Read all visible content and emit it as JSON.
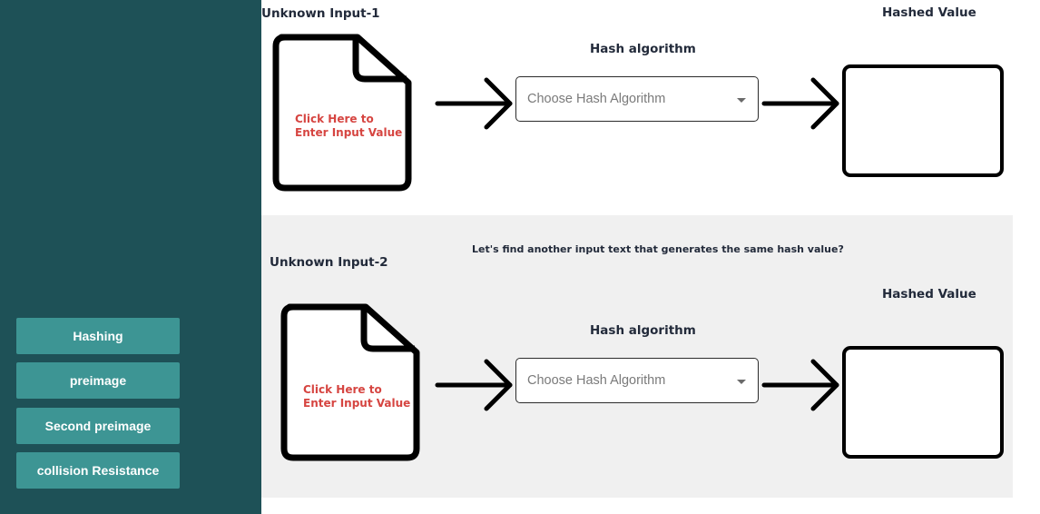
{
  "sidebar": {
    "items": [
      {
        "label": "Hashing"
      },
      {
        "label": "preimage"
      },
      {
        "label": "Second preimage"
      },
      {
        "label": "collision Resistance"
      }
    ]
  },
  "section1": {
    "input_title": "Unknown Input-1",
    "doc_text_line1": "Click Here to",
    "doc_text_line2": "Enter Input Value",
    "algo_title": "Hash algorithm",
    "select_placeholder": "Choose Hash Algorithm",
    "output_title": "Hashed Value",
    "output_value": ""
  },
  "section2": {
    "prompt": "Let's find another input text that generates the same hash value?",
    "input_title": "Unknown Input-2",
    "doc_text_line1": "Click Here to",
    "doc_text_line2": "Enter Input Value",
    "algo_title": "Hash algorithm",
    "select_placeholder": "Choose Hash Algorithm",
    "output_title": "Hashed Value",
    "output_value": ""
  },
  "icons": {
    "document": "document-icon",
    "arrow": "arrow-right-icon",
    "dropdown": "caret-down-icon"
  },
  "colors": {
    "sidebar_bg": "#1e5157",
    "nav_button_bg": "#3d9594",
    "doc_text": "#d64541",
    "panel2_bg": "#f0f0f0"
  }
}
